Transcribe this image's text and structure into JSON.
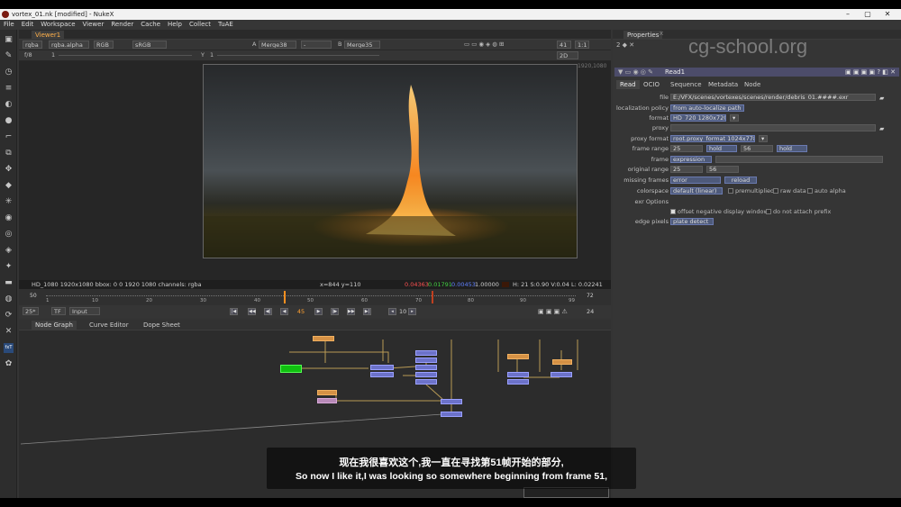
{
  "window": {
    "title": "vortex_01.nk [modified] - NukeX",
    "min": "–",
    "max": "▢",
    "close": "✕"
  },
  "menu": [
    "File",
    "Edit",
    "Workspace",
    "Viewer",
    "Render",
    "Cache",
    "Help",
    "Collect",
    "TuAE"
  ],
  "toolbar_icons": [
    "image-icon",
    "draw-icon",
    "time-icon",
    "channel-icon",
    "color-icon",
    "filter-icon",
    "keyer-icon",
    "merge-icon",
    "transform-icon",
    "3d-icon",
    "views-icon",
    "metadata-icon",
    "toolsets-icon",
    "other-icon",
    "particles-icon",
    "deep-icon",
    "furnace-icon",
    "nukex-icon",
    "cara-icon"
  ],
  "viewer": {
    "tab": "Viewer1",
    "channels": "rgba",
    "channel_alpha": "rgba.alpha",
    "display": "RGB",
    "lut": "sRGB",
    "a_label": "A",
    "a_input": "Merge38",
    "b_label": "B",
    "b_input": "Merge35",
    "dash": "-",
    "zoom": "41",
    "ratio": "1:1",
    "fstop": "f/8",
    "fstop_val": "1",
    "gamma_label": "Y",
    "gamma_val": "1",
    "dim": "2D",
    "format_label": "1920,1080",
    "info": "HD_1080 1920x1080  bbox: 0 0 1920 1080 channels: rgba",
    "coords": "x=844 y=110",
    "r": "0.04363",
    "g": "0.01791",
    "b": "0.00453",
    "a": "1.00000",
    "hsvl": "H: 21 S:0.90 V:0.04  L: 0.02241"
  },
  "timeline": {
    "start": "50",
    "end": "72",
    "ticks": [
      "1",
      "10",
      "20",
      "30",
      "40",
      "50",
      "60",
      "70",
      "80",
      "90",
      "99"
    ],
    "current": "45",
    "fps": "25*",
    "tf": "TF",
    "mode": "Input",
    "step": "10",
    "count": "24"
  },
  "nodegraph": {
    "tabs": [
      "Node Graph",
      "Curve Editor",
      "Dope Sheet"
    ]
  },
  "properties": {
    "title": "Properties",
    "node_name": "Read1",
    "close": "x",
    "tabs": [
      "Read",
      "OCIO",
      "Sequence",
      "Metadata",
      "Node"
    ],
    "file_label": "file",
    "file": "E:/VFX/scenes/vortexes/scenes/render/debris_01.####.exr",
    "localization_label": "localization policy",
    "localization": "from auto-localize path",
    "format_label": "format",
    "format": "HD_720 1280x720",
    "proxy_label": "proxy",
    "proxy_format_label": "proxy format",
    "proxy_format": "root.proxy_format 1024x778",
    "frame_range_label": "frame range",
    "range_start": "25",
    "range_before": "hold",
    "range_end": "56",
    "range_after": "hold",
    "frame_label": "frame",
    "frame_mode": "expression",
    "original_range_label": "original range",
    "orig_start": "25",
    "orig_end": "56",
    "missing_label": "missing frames",
    "missing": "error",
    "reload": "reload",
    "colorspace_label": "colorspace",
    "colorspace": "default (linear)",
    "premult": "premultiplied",
    "raw": "raw data",
    "auto_alpha": "auto alpha",
    "exr_label": "exr Options",
    "offset": "offset negative display window",
    "noattach": "do not attach prefix",
    "edge_label": "edge pixels",
    "edge": "plate detect"
  },
  "subtitle": {
    "zh": "现在我很喜欢这个,我一直在寻找第51帧开始的部分,",
    "en": "So now I like it,I was looking so somewhere beginning from frame 51,"
  },
  "watermark": "cg-school.org"
}
